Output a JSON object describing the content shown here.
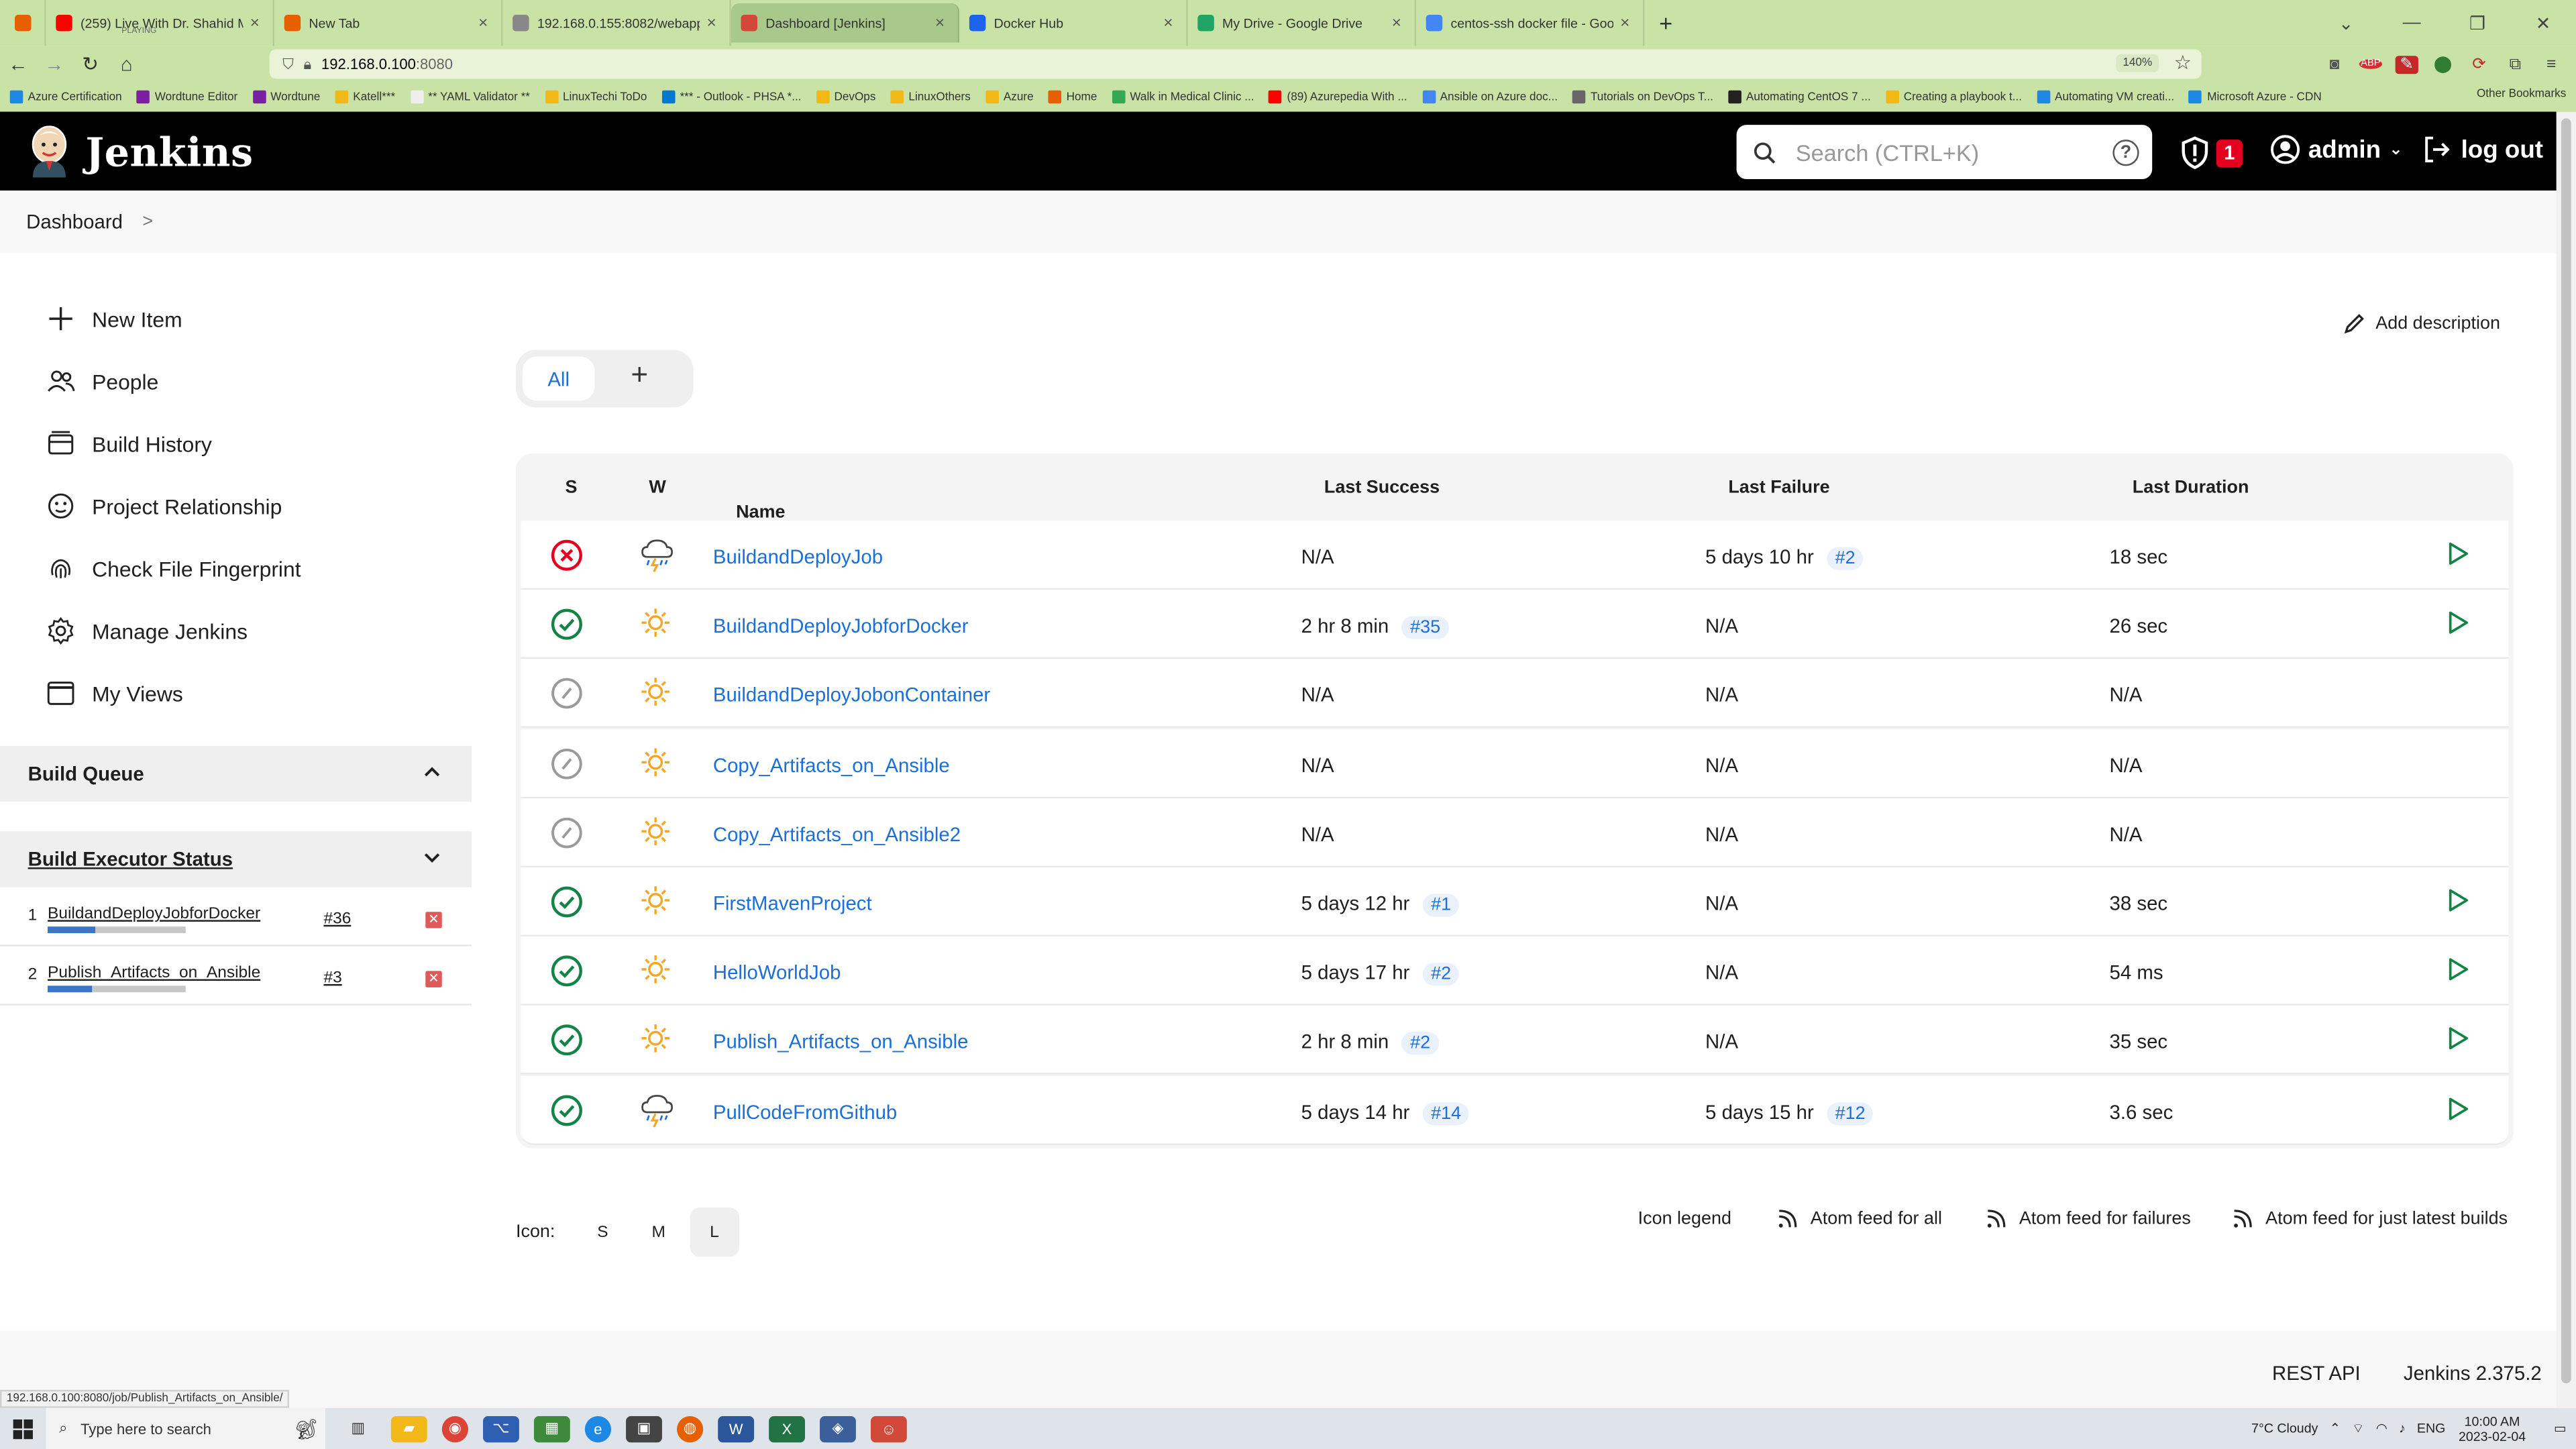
{
  "browser": {
    "tabs": [
      {
        "title": "(259) Live With Dr. Shahid Ma",
        "sub": "PLAYING",
        "color": "#ff0000"
      },
      {
        "title": "New Tab",
        "color": "#e66000"
      },
      {
        "title": "192.168.0.155:8082/webapp/",
        "color": "#888888"
      },
      {
        "title": "Dashboard [Jenkins]",
        "color": "#d24939"
      },
      {
        "title": "Docker Hub",
        "color": "#1d63ed"
      },
      {
        "title": "My Drive - Google Drive",
        "color": "#1fa463"
      },
      {
        "title": "centos-ssh docker file - Google",
        "color": "#4285f4"
      }
    ],
    "url_host": "192.168.0.100",
    "url_port": ":8080",
    "zoom": "140%",
    "bookmarks": [
      "Azure Certification",
      "Wordtune Editor",
      "Wordtune",
      "Katell***",
      "** YAML Validator **",
      "LinuxTechi ToDo",
      "*** - Outlook - PHSA *...",
      "DevOps",
      "LinuxOthers",
      "Azure",
      "Home",
      "Walk in Medical Clinic ...",
      "(89) Azurepedia With ...",
      "Ansible on Azure doc...",
      "Tutorials on DevOps T...",
      "Automating CentOS 7 ...",
      "Creating a playbook t...",
      "Automating VM creati...",
      "Microsoft Azure - CDN"
    ],
    "other_bookmarks": "Other Bookmarks",
    "status_url": "192.168.0.100:8080/job/Publish_Artifacts_on_Ansible/"
  },
  "header": {
    "brand": "Jenkins",
    "search_placeholder": "Search (CTRL+K)",
    "security_count": "1",
    "user": "admin",
    "logout": "log out"
  },
  "breadcrumb": {
    "root": "Dashboard"
  },
  "sidebar": {
    "tasks": [
      {
        "label": "New Item",
        "icon": "plus-icon"
      },
      {
        "label": "People",
        "icon": "people-icon"
      },
      {
        "label": "Build History",
        "icon": "build-history-icon"
      },
      {
        "label": "Project Relationship",
        "icon": "project-relationship-icon"
      },
      {
        "label": "Check File Fingerprint",
        "icon": "fingerprint-icon"
      },
      {
        "label": "Manage Jenkins",
        "icon": "gear-icon"
      },
      {
        "label": "My Views",
        "icon": "window-icon"
      }
    ],
    "build_queue": "Build Queue",
    "executor_status": "Build Executor Status",
    "executors": [
      {
        "num": "1",
        "job": "BuildandDeployJobforDocker",
        "build": "#36",
        "progress": 0.35
      },
      {
        "num": "2",
        "job": "Publish_Artifacts_on_Ansible",
        "build": "#3",
        "progress": 0.32
      }
    ]
  },
  "main": {
    "add_description": "Add description",
    "view_tab_all": "All",
    "columns": {
      "s": "S",
      "w": "W",
      "name": "Name",
      "name_sort": "↓",
      "last_success": "Last Success",
      "last_failure": "Last Failure",
      "last_duration": "Last Duration"
    },
    "jobs": [
      {
        "name": "BuildandDeployJob",
        "status": "failed",
        "weather": "storm",
        "success": "N/A",
        "success_build": "",
        "failure": "5 days 10 hr",
        "failure_build": "#2",
        "duration": "18 sec",
        "run": true
      },
      {
        "name": "BuildandDeployJobforDocker",
        "status": "success",
        "weather": "sunny",
        "success": "2 hr 8 min",
        "success_build": "#35",
        "failure": "N/A",
        "failure_build": "",
        "duration": "26 sec",
        "run": true
      },
      {
        "name": "BuildandDeployJobonContainer",
        "status": "notbuilt",
        "weather": "sunny",
        "success": "N/A",
        "success_build": "",
        "failure": "N/A",
        "failure_build": "",
        "duration": "N/A",
        "run": false
      },
      {
        "name": "Copy_Artifacts_on_Ansible",
        "status": "notbuilt",
        "weather": "sunny",
        "success": "N/A",
        "success_build": "",
        "failure": "N/A",
        "failure_build": "",
        "duration": "N/A",
        "run": false
      },
      {
        "name": "Copy_Artifacts_on_Ansible2",
        "status": "notbuilt",
        "weather": "sunny",
        "success": "N/A",
        "success_build": "",
        "failure": "N/A",
        "failure_build": "",
        "duration": "N/A",
        "run": false
      },
      {
        "name": "FirstMavenProject",
        "status": "success",
        "weather": "sunny",
        "success": "5 days 12 hr",
        "success_build": "#1",
        "failure": "N/A",
        "failure_build": "",
        "duration": "38 sec",
        "run": true
      },
      {
        "name": "HelloWorldJob",
        "status": "success",
        "weather": "sunny",
        "success": "5 days 17 hr",
        "success_build": "#2",
        "failure": "N/A",
        "failure_build": "",
        "duration": "54 ms",
        "run": true
      },
      {
        "name": "Publish_Artifacts_on_Ansible",
        "status": "success",
        "weather": "sunny",
        "success": "2 hr 8 min",
        "success_build": "#2",
        "failure": "N/A",
        "failure_build": "",
        "duration": "35 sec",
        "run": true
      },
      {
        "name": "PullCodeFromGithub",
        "status": "success",
        "weather": "storm",
        "success": "5 days 14 hr",
        "success_build": "#14",
        "failure": "5 days 15 hr",
        "failure_build": "#12",
        "duration": "3.6 sec",
        "run": true
      }
    ],
    "icon_label": "Icon:",
    "icon_sizes": [
      "S",
      "M",
      "L"
    ],
    "icon_legend": "Icon legend",
    "feeds": [
      "Atom feed for all",
      "Atom feed for failures",
      "Atom feed for just latest builds"
    ]
  },
  "footer": {
    "rest_api": "REST API",
    "version": "Jenkins 2.375.2"
  },
  "taskbar": {
    "search_placeholder": "Type here to search",
    "weather": "7°C  Cloudy",
    "lang": "ENG",
    "time": "10:00 AM",
    "date": "2023-02-04"
  },
  "colors": {
    "success": "#138347",
    "failure": "#e6001f",
    "link": "#1b6fd6",
    "notbuilt": "#9a9a9a",
    "sunny": "#f5a623"
  }
}
